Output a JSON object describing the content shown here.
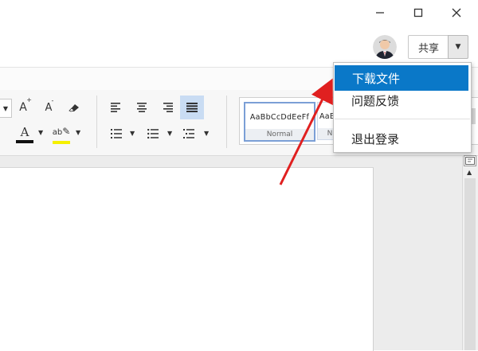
{
  "window": {
    "minimize_icon": "minimize-icon",
    "maximize_icon": "maximize-icon",
    "close_icon": "close-icon"
  },
  "header": {
    "share_label": "共享",
    "avatar_icon": "user-avatar-icon"
  },
  "account_menu": {
    "items": [
      {
        "label": "下载文件",
        "selected": true
      },
      {
        "label": "问题反馈",
        "selected": false
      },
      {
        "label": "退出登录",
        "selected": false
      }
    ],
    "highlight_color": "#0a78c8"
  },
  "ribbon": {
    "font_color": "#d10000",
    "highlight_color": "#ffff00",
    "font_color_letter": "A",
    "highlight_glyph": "ab",
    "grow_font_letter": "A",
    "shrink_font_letter": "A",
    "styles": [
      {
        "sample": "AaBbCcDdEeFf",
        "name": "Normal"
      },
      {
        "sample": "AaB",
        "name": "N"
      }
    ]
  },
  "annotation": {
    "arrow_color": "#e02020"
  }
}
